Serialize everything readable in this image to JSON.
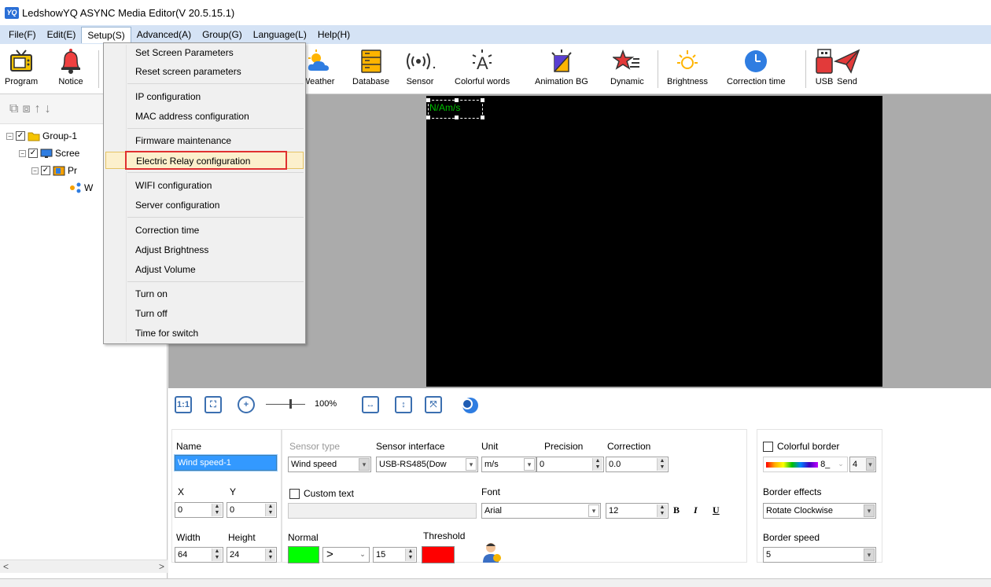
{
  "window": {
    "logo": "YQ",
    "title": "LedshowYQ ASYNC Media Editor(V 20.5.15.1)"
  },
  "menubar": [
    "File(F)",
    "Edit(E)",
    "Setup(S)",
    "Advanced(A)",
    "Group(G)",
    "Language(L)",
    "Help(H)"
  ],
  "toolbar": {
    "program": "Program",
    "notice": "Notice",
    "weather": "Weather",
    "database": "Database",
    "sensor": "Sensor",
    "colorful_words": "Colorful words",
    "animation_bg": "Animation BG",
    "dynamic": "Dynamic",
    "brightness": "Brightness",
    "correction_time": "Correction time",
    "usb": "USB",
    "send": "Send"
  },
  "tree": {
    "group": "Group-1",
    "screen": "Scree",
    "program": "Pr",
    "item": "W"
  },
  "canvas": {
    "sensor_text": "N/Am/s"
  },
  "zoom": {
    "level": "100%",
    "fit_label": "1:1"
  },
  "props": {
    "name_label": "Name",
    "name_value": "Wind speed-1",
    "sensor_type_label": "Sensor type",
    "sensor_type_value": "Wind speed",
    "sensor_interface_label": "Sensor interface",
    "sensor_interface_value": "USB-RS485(Dow",
    "unit_label": "Unit",
    "unit_value": "m/s",
    "precision_label": "Precision",
    "precision_value": "0",
    "correction_label": "Correction",
    "correction_value": "0.0",
    "x_label": "X",
    "x_value": "0",
    "y_label": "Y",
    "y_value": "0",
    "custom_text_label": "Custom text",
    "font_label": "Font",
    "font_value": "Arial",
    "font_size": "12",
    "bold": "B",
    "italic": "I",
    "underline": "U",
    "width_label": "Width",
    "width_value": "64",
    "height_label": "Height",
    "height_value": "24",
    "normal_label": "Normal",
    "operator": ">",
    "threshold_value": "15",
    "threshold_label": "Threshold",
    "normal_color": "#00ff00",
    "threshold_color": "#ff0000",
    "colorful_border_label": "Colorful border",
    "border_pattern_value": "8_",
    "border_width_value": "4",
    "border_effects_label": "Border effects",
    "border_effects_value": "Rotate Clockwise",
    "border_speed_label": "Border speed",
    "border_speed_value": "5"
  },
  "setup_menu": {
    "items": [
      "Set Screen Parameters",
      "Reset screen parameters",
      "IP configuration",
      "MAC address configuration",
      "Firmware maintenance",
      "Electric Relay configuration",
      "WIFI configuration",
      "Server configuration",
      "Correction time",
      "Adjust Brightness",
      "Adjust Volume",
      "Turn on",
      "Turn off",
      "Time for switch"
    ],
    "highlighted": "Electric Relay configuration"
  }
}
